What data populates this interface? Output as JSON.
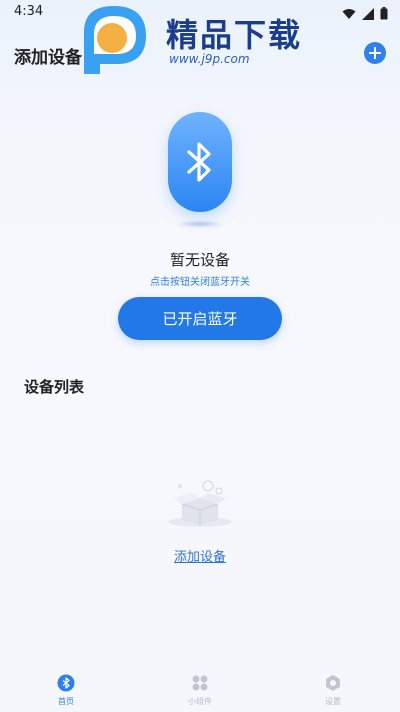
{
  "status_bar": {
    "time": "4:34",
    "icons": [
      "wifi-icon",
      "signal-icon",
      "battery-icon"
    ]
  },
  "watermark": {
    "logo_text": "精品下载",
    "url": "www.j9p.com"
  },
  "header": {
    "title": "添加设备",
    "add_icon": "plus-icon"
  },
  "bluetooth_card": {
    "icon": "bluetooth-icon",
    "empty_title": "暂无设备",
    "hint": "点击按钮关闭蓝牙开关",
    "button_label": "已开启蓝牙"
  },
  "device_list": {
    "title": "设备列表",
    "empty_icon": "empty-box-icon",
    "add_link": "添加设备"
  },
  "tabbar": {
    "items": [
      {
        "label": "首页",
        "icon": "bluetooth-icon",
        "active": true
      },
      {
        "label": "小组件",
        "icon": "grid-icon",
        "active": false
      },
      {
        "label": "设置",
        "icon": "gear-icon",
        "active": false
      }
    ]
  },
  "colors": {
    "accent": "#2178e6",
    "link": "#2f73d8",
    "inactive": "#b8bcc6"
  }
}
